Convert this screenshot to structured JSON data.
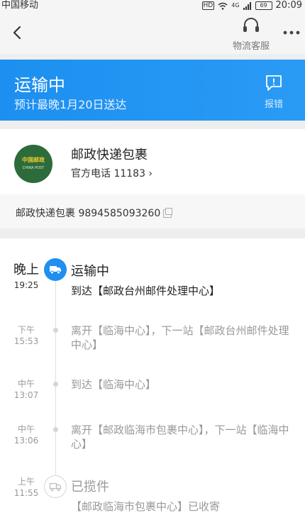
{
  "status_bar": {
    "carrier": "中国移动",
    "hd": "HD",
    "signal": "4G",
    "battery": "69",
    "time": "20:09"
  },
  "nav": {
    "customer_service_label": "物流客服"
  },
  "banner": {
    "title": "运输中",
    "subtitle": "预计最晚1月20日送达",
    "report_label": "报错",
    "color": "#1c8ff0"
  },
  "carrier": {
    "logo_text": "中国邮政",
    "logo_en": "CHINA POST",
    "name": "邮政快递包裹",
    "phone": "官方电话 11183 ›",
    "tracking": "邮政快递包裹 9894585093260"
  },
  "timeline": [
    {
      "period": "晚上",
      "time": "19:25",
      "status": "运输中",
      "desc": "到达【邮政台州邮件处理中心】"
    },
    {
      "period": "下午",
      "time": "15:53",
      "desc": "离开【临海中心】，下一站【邮政台州邮件处理中心】"
    },
    {
      "period": "中午",
      "time": "13:07",
      "desc": "到达【临海中心】"
    },
    {
      "period": "中午",
      "time": "13:06",
      "desc": "离开【邮政临海市包裹中心】，下一站【临海中心】"
    },
    {
      "period": "上午",
      "time": "11:55",
      "status": "已揽件",
      "desc": "【邮政临海市包裹中心】已收寄"
    }
  ]
}
